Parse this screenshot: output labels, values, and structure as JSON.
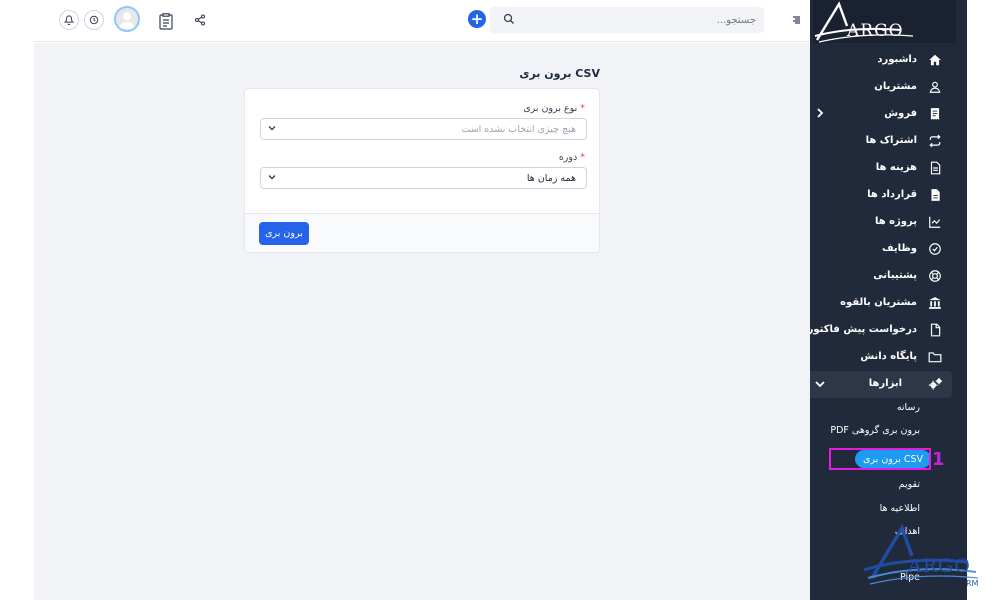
{
  "header": {
    "search_placeholder": "جستجو...",
    "icons": [
      "notification-bell-icon",
      "clock-icon",
      "avatar",
      "clipboard-icon",
      "share-icon",
      "plus-icon",
      "search-icon",
      "menu-toggle-icon"
    ]
  },
  "page": {
    "title": "برون بری CSV"
  },
  "form": {
    "export_type": {
      "label": "نوع برون بری",
      "required_mark": "*",
      "value": "هیچ چیزی انتخاب نشده است"
    },
    "period": {
      "label": "دوره",
      "required_mark": "*",
      "value": "همه زمان ها"
    },
    "submit_label": "برون بری"
  },
  "sidebar": {
    "logo_text": "ARGO",
    "items": [
      {
        "label": "داشبورد",
        "icon": "home-icon"
      },
      {
        "label": "مشتریان",
        "icon": "user-icon"
      },
      {
        "label": "فروش",
        "icon": "receipt-icon"
      },
      {
        "label": "اشتراک ها",
        "icon": "repeat-icon"
      },
      {
        "label": "هزینه ها",
        "icon": "file-text-icon"
      },
      {
        "label": "قرارداد ها",
        "icon": "file-icon"
      },
      {
        "label": "پروژه ها",
        "icon": "chart-icon"
      },
      {
        "label": "وظایف",
        "icon": "check-circle-icon"
      },
      {
        "label": "پشتیبانی",
        "icon": "life-ring-icon"
      },
      {
        "label": "مشتریان بالقوه",
        "icon": "bank-icon"
      },
      {
        "label": "درخواست پیش فاکتور",
        "icon": "document-icon"
      },
      {
        "label": "پایگاه دانش",
        "icon": "folder-icon"
      },
      {
        "label": "ابزارها",
        "icon": "gears-icon"
      }
    ],
    "sub_items": [
      "رسانه",
      "برون بری گروهی PDF",
      "برون بری CSV",
      "تقویم",
      "اطلاعیه ها",
      "اهداف",
      "Pipe"
    ],
    "active_sub": "برون بری CSV"
  },
  "annotation": {
    "step_number": "1"
  },
  "watermark": {
    "text": "ARGO",
    "suffix": "RM"
  },
  "colors": {
    "accent": "#2563eb",
    "sidebar_bg": "#212a3a",
    "pill": "#1d9bf0",
    "highlight": "#e31ce0"
  }
}
